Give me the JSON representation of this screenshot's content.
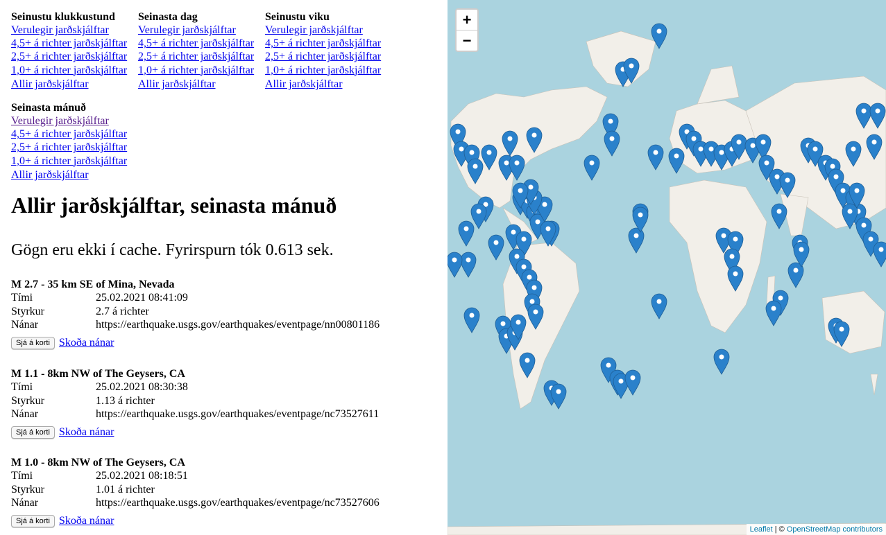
{
  "nav": [
    {
      "heading": "Seinustu klukkustund",
      "links": [
        "Verulegir jarðskjálftar",
        "4,5+ á richter jarðskjálftar",
        "2,5+ á richter jarðskjálftar",
        "1,0+ á richter jarðskjálftar",
        "Allir jarðskjálftar"
      ]
    },
    {
      "heading": "Seinasta dag",
      "links": [
        "Verulegir jarðskjálftar",
        "4,5+ á richter jarðskjálftar",
        "2,5+ á richter jarðskjálftar",
        "1,0+ á richter jarðskjálftar",
        "Allir jarðskjálftar"
      ]
    },
    {
      "heading": "Seinustu viku",
      "links": [
        "Verulegir jarðskjálftar",
        "4,5+ á richter jarðskjálftar",
        "2,5+ á richter jarðskjálftar",
        "1,0+ á richter jarðskjálftar",
        "Allir jarðskjálftar"
      ]
    },
    {
      "heading": "Seinasta mánuð",
      "links": [
        "Verulegir jarðskjálftar",
        "4,5+ á richter jarðskjálftar",
        "2,5+ á richter jarðskjálftar",
        "1,0+ á richter jarðskjálftar",
        "Allir jarðskjálftar"
      ]
    }
  ],
  "page_title": "Allir jarðskjálftar, seinasta mánuð",
  "cache_info": "Gögn eru ekki í cache. Fyrirspurn tók 0.613 sek.",
  "labels": {
    "time": "Tími",
    "magnitude": "Styrkur",
    "details": "Nánar",
    "show_on_map": "Sjá á korti",
    "view_details": "Skoða nánar"
  },
  "quakes": [
    {
      "title": "M 2.7 - 35 km SE of Mina, Nevada",
      "time": "25.02.2021 08:41:09",
      "magnitude": "2.7 á richter",
      "url": "https://earthquake.usgs.gov/earthquakes/eventpage/nn00801186"
    },
    {
      "title": "M 1.1 - 8km NW of The Geysers, CA",
      "time": "25.02.2021 08:30:38",
      "magnitude": "1.13 á richter",
      "url": "https://earthquake.usgs.gov/earthquakes/eventpage/nc73527611"
    },
    {
      "title": "M 1.0 - 8km NW of The Geysers, CA",
      "time": "25.02.2021 08:18:51",
      "magnitude": "1.01 á richter",
      "url": "https://earthquake.usgs.gov/earthquakes/eventpage/nc73527606"
    }
  ],
  "map": {
    "zoom_in": "+",
    "zoom_out": "−",
    "attribution_leaflet": "Leaflet",
    "attribution_sep": " | © ",
    "attribution_osm": "OpenStreetMap contributors",
    "colors": {
      "water": "#aad3df",
      "land": "#f2efe9",
      "marker": "#2a81cb"
    }
  }
}
